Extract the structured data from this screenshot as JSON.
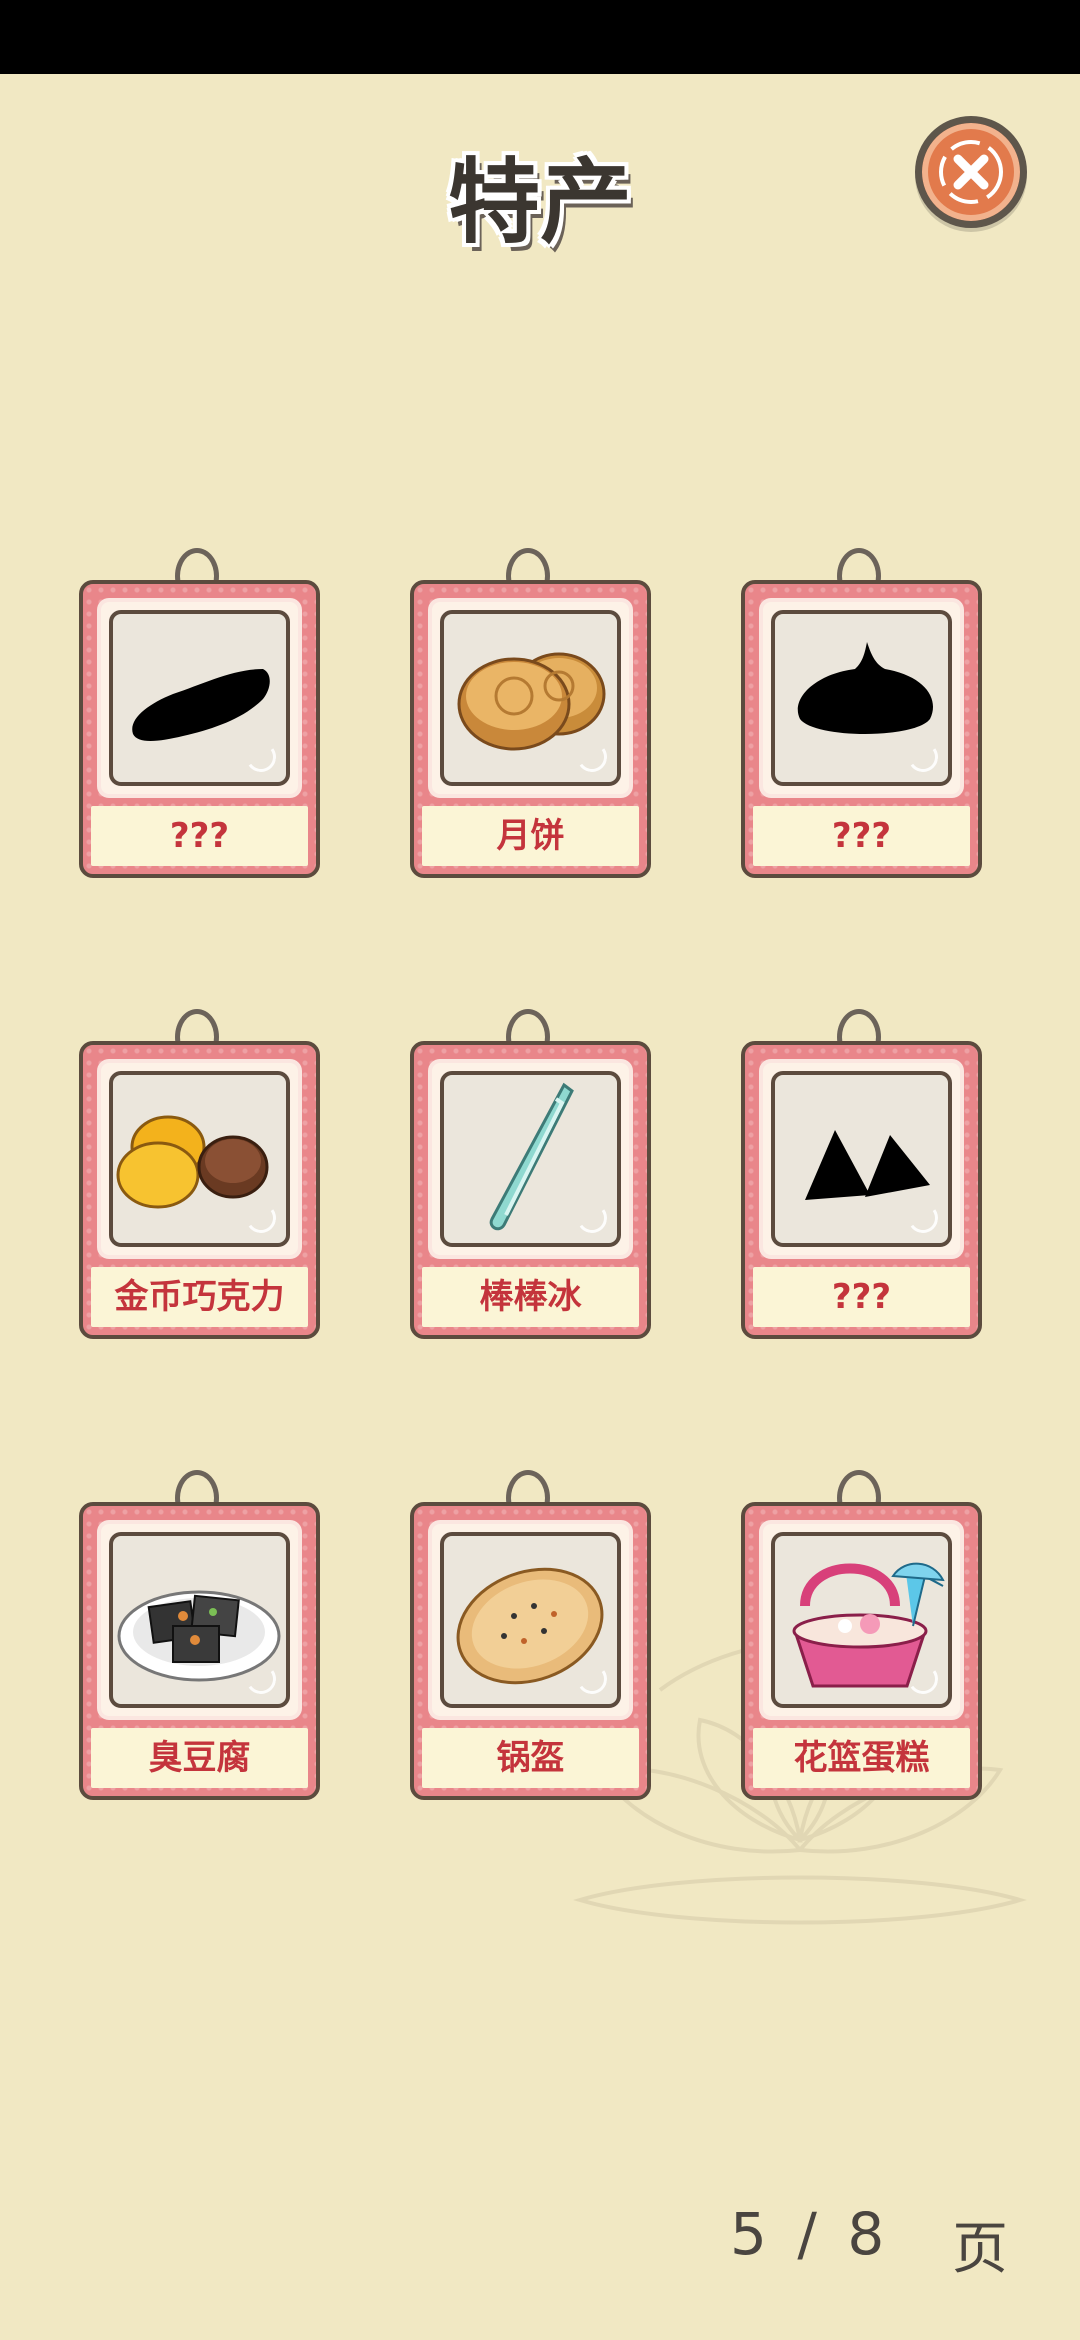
{
  "title": "特产",
  "cards": [
    {
      "label": "???",
      "image": "silhouette-sweet-potato"
    },
    {
      "label": "月饼",
      "image": "mooncake"
    },
    {
      "label": "???",
      "image": "silhouette-dumpling"
    },
    {
      "label": "金币巧克力",
      "image": "gold-coin-chocolate"
    },
    {
      "label": "棒棒冰",
      "image": "ice-pop"
    },
    {
      "label": "???",
      "image": "silhouette-zongzi"
    },
    {
      "label": "臭豆腐",
      "image": "stinky-tofu"
    },
    {
      "label": "锅盔",
      "image": "guokui-flatbread"
    },
    {
      "label": "花篮蛋糕",
      "image": "flower-basket-cake"
    }
  ],
  "pagination": {
    "current": "5",
    "separator": "/",
    "total": "8",
    "unit": "页"
  },
  "colors": {
    "background": "#f1e8c3",
    "card": "#e9868a",
    "label_text": "#c4343c",
    "close": "#e27a4c"
  }
}
